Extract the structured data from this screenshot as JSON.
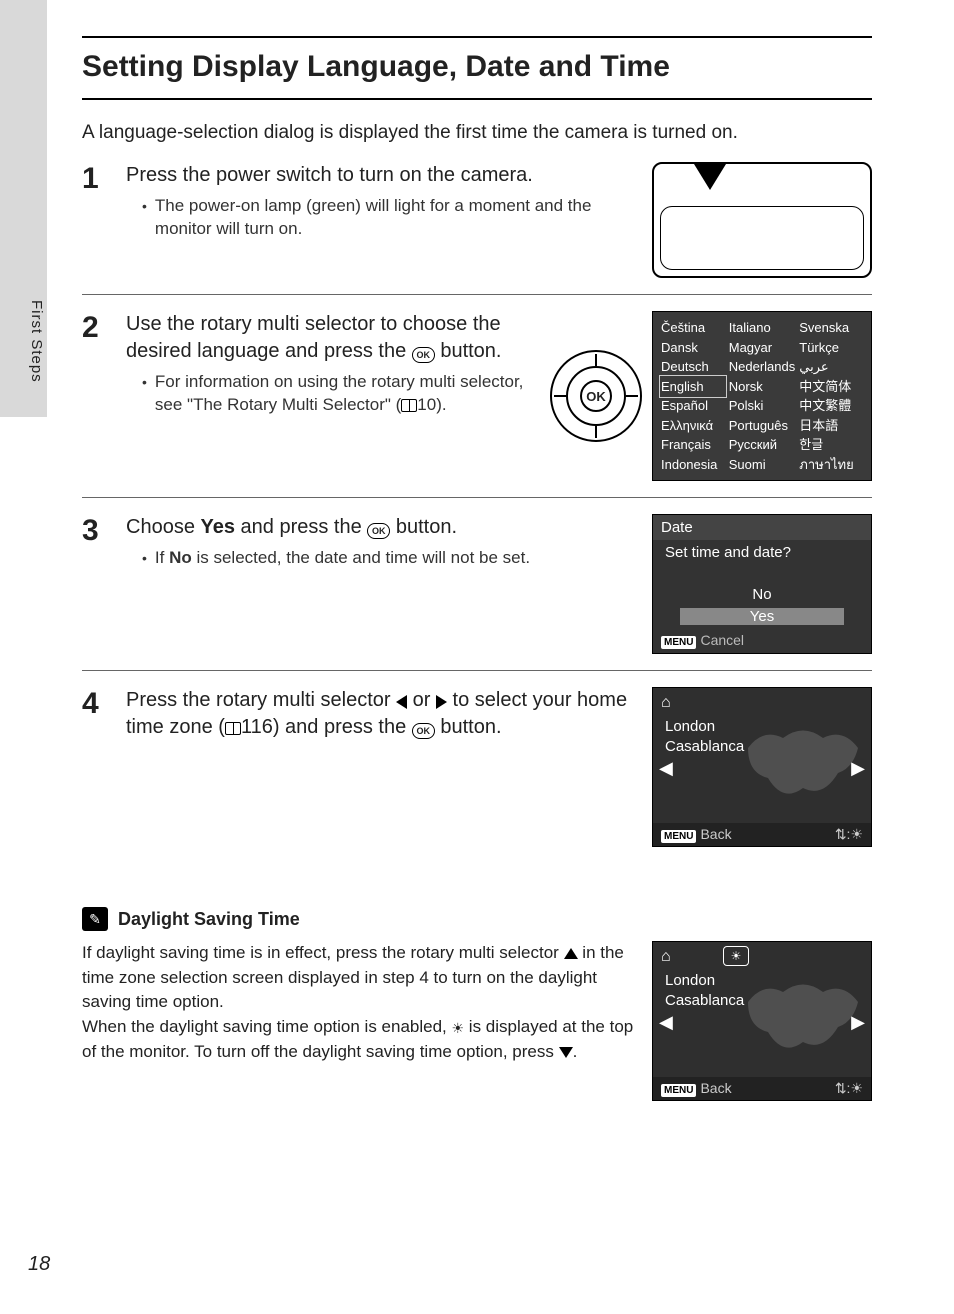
{
  "sideLabel": "First Steps",
  "pageNumber": "18",
  "title": "Setting Display Language, Date and Time",
  "intro": "A language-selection dialog is displayed the first time the camera is turned on.",
  "icons": {
    "ok": "OK",
    "menu": "MENU"
  },
  "steps": {
    "s1": {
      "num": "1",
      "head": "Press the power switch to turn on the camera.",
      "bullet": "The power-on lamp (green) will light for a moment and the monitor will turn on."
    },
    "s2": {
      "num": "2",
      "head_a": "Use the rotary multi selector to choose the desired language and press the ",
      "head_b": " button.",
      "bullet_a": "For information on using the rotary multi selector, see \"The Rotary Multi Selector\" (",
      "bullet_b": "10)."
    },
    "s3": {
      "num": "3",
      "head_a": "Choose ",
      "head_yes": "Yes",
      "head_b": " and press the ",
      "head_c": " button.",
      "bullet_a": "If ",
      "bullet_no": "No",
      "bullet_b": " is selected, the date and time will not be set."
    },
    "s4": {
      "num": "4",
      "head_a": "Press the rotary multi selector ",
      "head_b": " or ",
      "head_c": " to select your home time zone (",
      "head_d": "116) and press the ",
      "head_e": " button."
    }
  },
  "langPanel": {
    "col1": [
      "Čeština",
      "Dansk",
      "Deutsch",
      "English",
      "Español",
      "Ελληνικά",
      "Français",
      "Indonesia"
    ],
    "col2": [
      "Italiano",
      "Magyar",
      "Nederlands",
      "Norsk",
      "Polski",
      "Português",
      "Русский",
      "Suomi"
    ],
    "col3": [
      "Svenska",
      "Türkçe",
      "عربي",
      "中文简体",
      "中文繁體",
      "日本語",
      "한글",
      "ภาษาไทย"
    ]
  },
  "datePanel": {
    "title": "Date",
    "question": "Set time and date?",
    "no": "No",
    "yes": "Yes",
    "cancel": "Cancel"
  },
  "tzPanel": {
    "home": "⌂",
    "city1": "London",
    "city2": "Casablanca",
    "back": "Back",
    "dstSymbol": "☀"
  },
  "note": {
    "title": "Daylight Saving Time",
    "p1a": "If daylight saving time is in effect, press the rotary multi selector ",
    "p1b": " in the time zone selection screen displayed in step 4 to turn on the daylight saving time option.",
    "p2a": "When the daylight saving time option is enabled, ",
    "p2b": " is displayed at the top of the monitor. To turn off the daylight saving time option, press ",
    "p2c": "."
  }
}
